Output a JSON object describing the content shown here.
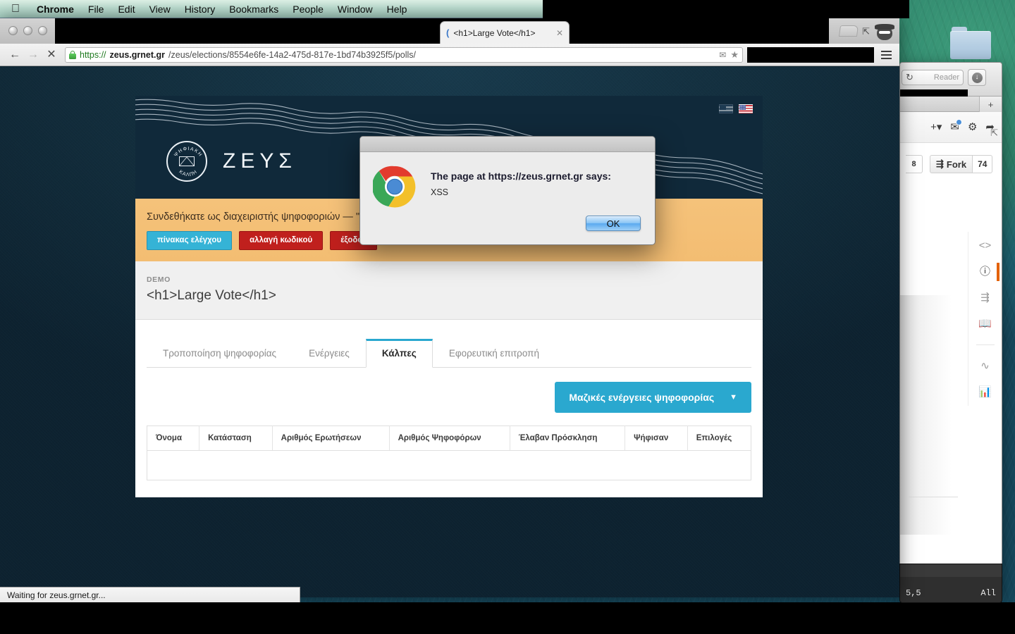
{
  "os": {
    "menubar": {
      "apple_icon": "apple-icon",
      "items": [
        {
          "label": "Chrome",
          "bold": true
        },
        {
          "label": "File",
          "bold": false
        },
        {
          "label": "Edit",
          "bold": false
        },
        {
          "label": "View",
          "bold": false
        },
        {
          "label": "History",
          "bold": false
        },
        {
          "label": "Bookmarks",
          "bold": false
        },
        {
          "label": "People",
          "bold": false
        },
        {
          "label": "Window",
          "bold": false
        },
        {
          "label": "Help",
          "bold": false
        }
      ]
    }
  },
  "browser": {
    "tab": {
      "title": "<h1>Large Vote</h1>",
      "favicon": "loading-spinner-icon",
      "close_icon": "close-icon"
    },
    "toolbar": {
      "back_icon": "back-arrow-icon",
      "forward_icon": "forward-arrow-icon",
      "stop_icon": "stop-x-icon",
      "menu_icon": "hamburger-menu-icon",
      "url_scheme": "https://",
      "url_domain": "zeus.grnet.gr",
      "url_path": "/zeus/elections/8554e6fe-14a2-475d-817e-1bd74b3925f5/polls/",
      "envelope_icon": "envelope-icon",
      "bookmark_icon": "star-icon"
    },
    "window_controls": [
      "close",
      "minimize",
      "zoom"
    ],
    "incognito_icon": "incognito-spy-icon",
    "new_tab_icon": "new-tab-icon",
    "fullscreen_icon": "fullscreen-arrows-icon",
    "status_text": "Waiting for zeus.grnet.gr..."
  },
  "dialog": {
    "icon": "chrome-logo-icon",
    "heading": "The page at https://zeus.grnet.gr says:",
    "message": "XSS",
    "ok_label": "OK"
  },
  "page": {
    "header": {
      "brand": "ΖΕΥΣ",
      "seal_top_text": "ΨΗΦΙΑΚΗ",
      "seal_bottom_text": "ΚΑΛΠΗ",
      "seal_icon": "envelope-icon",
      "languages": [
        {
          "name": "greek-flag",
          "active": false
        },
        {
          "name": "us-flag",
          "active": true
        }
      ]
    },
    "notice": {
      "text": "Συνδεθήκατε ως διαχειριστής ψηφοφοριών — \"",
      "buttons": [
        {
          "label": "πίνακας ελέγχου",
          "style": "cyan"
        },
        {
          "label": "αλλαγή κωδικού",
          "style": "red"
        },
        {
          "label": "έξοδος",
          "style": "red"
        }
      ]
    },
    "title_block": {
      "eyebrow": "DEMO",
      "title": "<h1>Large Vote</h1>"
    },
    "tabs": [
      {
        "label": "Τροποποίηση ψηφοφορίας",
        "active": false
      },
      {
        "label": "Ενέργειες",
        "active": false
      },
      {
        "label": "Κάλπες",
        "active": true
      },
      {
        "label": "Εφορευτική επιτροπή",
        "active": false
      }
    ],
    "bulk_actions": {
      "label": "Μαζικές ενέργειες ψηφοφορίας",
      "caret_icon": "chevron-down-icon"
    },
    "table": {
      "columns": [
        "Όνομα",
        "Κατάσταση",
        "Αριθμός Ερωτήσεων",
        "Αριθμός Ψηφοφόρων",
        "Έλαβαν Πρόσκληση",
        "Ψήφισαν",
        "Επιλογές"
      ],
      "rows": []
    }
  },
  "background_window": {
    "reader_label": "Reader",
    "reload_icon": "reload-icon",
    "download_icon": "download-icon",
    "new_tab_icon": "plus-icon",
    "expand_icon": "expand-arrows-icon",
    "actions": [
      {
        "name": "add-dropdown-icon"
      },
      {
        "name": "inbox-notification-icon"
      },
      {
        "name": "gear-icon"
      },
      {
        "name": "sign-out-icon"
      }
    ],
    "watch_count": "8",
    "fork_label": "Fork",
    "fork_count": "74",
    "fork_icon": "fork-icon",
    "sidebar_icons": [
      {
        "name": "code-icon",
        "active": false
      },
      {
        "name": "issues-icon",
        "active": true
      },
      {
        "name": "pull-requests-icon",
        "active": false
      },
      {
        "name": "wiki-book-icon",
        "active": false
      },
      {
        "name": "pulse-icon",
        "active": false
      },
      {
        "name": "graphs-icon",
        "active": false
      }
    ]
  },
  "terminal": {
    "position": "5,5",
    "scroll": "All"
  },
  "colors": {
    "accent_cyan": "#2aa8cf",
    "notice_orange": "#f3bd72",
    "danger_red": "#c0201d",
    "header_navy": "#10293a",
    "page_navy": "#0f2735"
  }
}
